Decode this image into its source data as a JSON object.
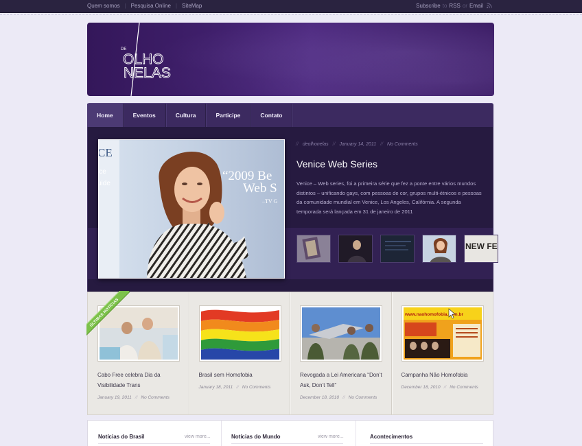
{
  "topbar": {
    "links": [
      "Quem somos",
      "Pesquisa Online",
      "SiteMap"
    ],
    "subscribe_label": "Subscribe",
    "via": "to",
    "rss": "RSS",
    "or": "or",
    "email": "Email"
  },
  "nav": {
    "items": [
      "Home",
      "Eventos",
      "Cultura",
      "Participe",
      "Contato"
    ],
    "active": "Home"
  },
  "featured": {
    "author": "deolhonelas",
    "date": "January 14, 2011",
    "comments": "No Comments",
    "title": "Venice Web Series",
    "excerpt": "Venice – Web series, foi a primeira série que fez a ponte entre vários mundos distintos – unificando gays, com pessoas de cor, grupos multi-étnicos e pessoas da comunidade mundial em Venice, Los Angeles, Califórnia. A segunda temporada será lançada em 31 de janeiro de 2011",
    "image_text_1": "CE",
    "image_text_2": "ice",
    "image_text_3": "uide",
    "image_text_4": "“2009 Be",
    "image_text_5": "Web S",
    "image_text_6": "–TV G",
    "thumb_text": "NEW FEST"
  },
  "latest": {
    "ribbon": "ÚLTIMAS NOTÍCIAS",
    "posts": [
      {
        "title": "Cabo Free celebra Dia da Visibilidade Trans",
        "date": "January 19, 2011",
        "comments": "No Comments"
      },
      {
        "title": "Brasil sem Homofobia",
        "date": "January 18, 2011",
        "comments": "No Comments"
      },
      {
        "title": "Revogada a Lei Americana “Don’t Ask, Don’t Tell”",
        "date": "December 18, 2010",
        "comments": "No Comments"
      },
      {
        "title": "Campanha Não Homofobia",
        "date": "December 18, 2010",
        "comments": "No Comments"
      }
    ],
    "nao_url": "www.naohomofobia.com.br"
  },
  "widgets": {
    "brasil_title": "Notícias do Brasil",
    "mundo_title": "Notícias do Mundo",
    "acontecimentos_title": "Acontecimentos",
    "view_more": "view more..."
  },
  "colors": {
    "topbar": "#2a2340",
    "header": "#3f1f6b",
    "nav": "#3c2a60",
    "featured": "#261a40",
    "ribbon": "#7cc14a"
  }
}
